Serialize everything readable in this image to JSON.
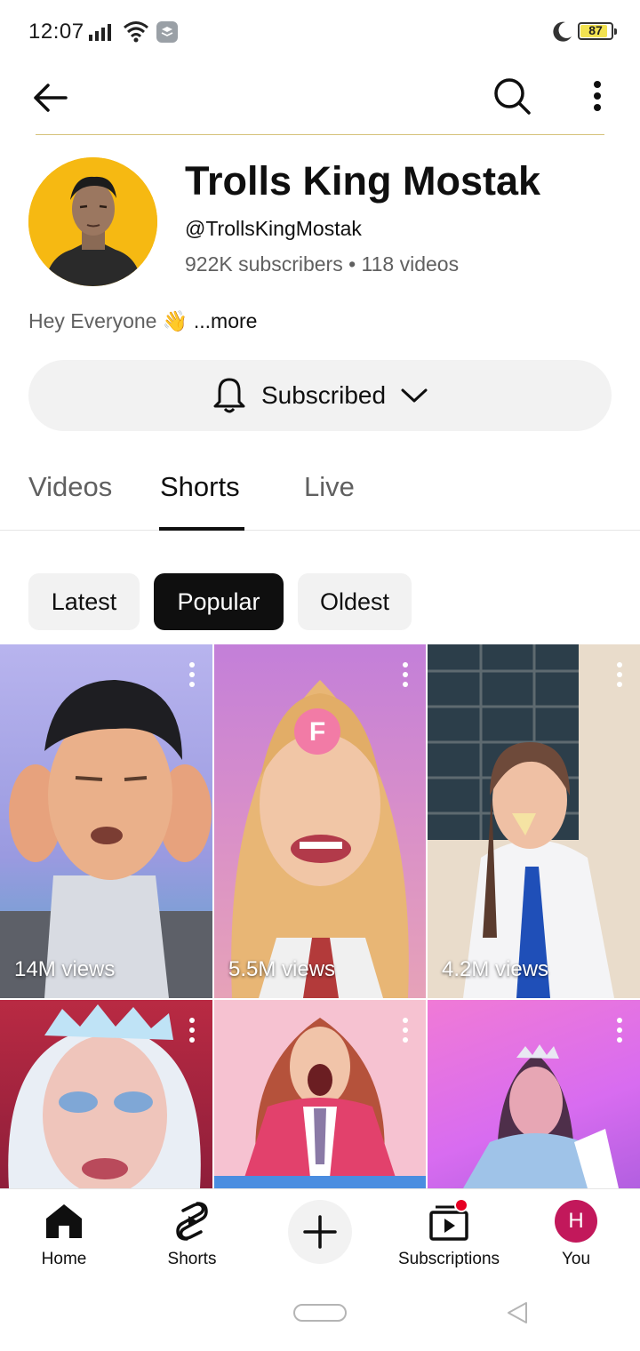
{
  "status_bar": {
    "time": "12:07",
    "battery_level": "87",
    "battery_fraction": 0.87,
    "icons": [
      "signal-icon",
      "wifi-icon",
      "stack-app-icon",
      "moon-icon",
      "battery-icon"
    ]
  },
  "top_bar": {
    "icons": [
      "back-arrow-icon",
      "search-icon",
      "more-vert-icon"
    ]
  },
  "channel": {
    "name": "Trolls King Mostak",
    "handle": "@TrollsKingMostak",
    "stats": "922K subscribers • 118 videos",
    "description": "Hey Everyone 👋",
    "more_label": " ...more",
    "avatar_bg": "#f6b912"
  },
  "subscribe": {
    "label": "Subscribed",
    "icons": [
      "bell-icon",
      "chevron-down-icon"
    ]
  },
  "tabs": [
    {
      "label": "Videos"
    },
    {
      "label": "Shorts",
      "active": true
    },
    {
      "label": "Live"
    }
  ],
  "chips": [
    {
      "label": "Latest"
    },
    {
      "label": "Popular",
      "selected": true
    },
    {
      "label": "Oldest"
    }
  ],
  "shorts": [
    {
      "views": "14M views"
    },
    {
      "views": "5.5M views"
    },
    {
      "views": "4.2M views"
    },
    {
      "views": ""
    },
    {
      "views": ""
    },
    {
      "views": ""
    }
  ],
  "bottom_nav": {
    "home": "Home",
    "shorts": "Shorts",
    "subscriptions": "Subscriptions",
    "you": "You",
    "you_initial": "H"
  },
  "colors": {
    "accent": "#0f0f0f",
    "secondary_text": "#606060",
    "chip_bg": "#f2f2f2",
    "notification": "#e60023",
    "profile": "#c2185b"
  }
}
